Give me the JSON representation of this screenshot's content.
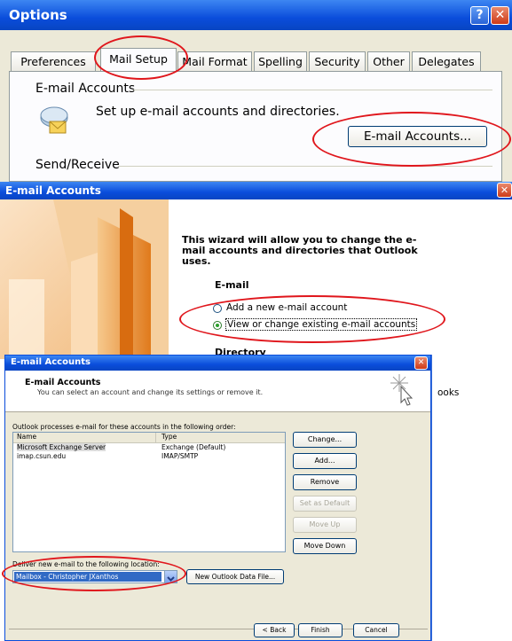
{
  "options": {
    "title": "Options",
    "help_glyph": "?",
    "close_glyph": "✕",
    "tabs": [
      "Preferences",
      "Mail Setup",
      "Mail Format",
      "Spelling",
      "Security",
      "Other",
      "Delegates"
    ],
    "active_tab": "Mail Setup",
    "email_accounts_heading": "E-mail Accounts",
    "email_accounts_desc": "Set up e-mail accounts and directories.",
    "email_accounts_button": "E-mail Accounts...",
    "send_receive_heading": "Send/Receive"
  },
  "wizard": {
    "title": "E-mail Accounts",
    "intro": "This wizard will allow you to change the e-mail accounts and directories that Outlook uses.",
    "email_heading": "E-mail",
    "radio_add": "Add a new e-mail account",
    "radio_view": "View or change existing e-mail accounts",
    "directory_heading": "Directory",
    "partial_text": "ooks"
  },
  "accounts": {
    "title": "E-mail Accounts",
    "header_title": "E-mail Accounts",
    "header_subtitle": "You can select an account and change its settings or remove it.",
    "order_label": "Outlook processes e-mail for these accounts in the following order:",
    "columns": [
      "Name",
      "Type"
    ],
    "rows": [
      {
        "name": "Microsoft Exchange Server",
        "type": "Exchange (Default)"
      },
      {
        "name": "imap.csun.edu",
        "type": "IMAP/SMTP"
      }
    ],
    "buttons": {
      "change": "Change...",
      "add": "Add...",
      "remove": "Remove",
      "set_default": "Set as Default",
      "move_up": "Move Up",
      "move_down": "Move Down"
    },
    "deliver_label": "Deliver new e-mail to the following location:",
    "deliver_value": "Mailbox - Christopher JXanthos",
    "new_data_file": "New Outlook Data File...",
    "back": "< Back",
    "finish": "Finish",
    "cancel": "Cancel"
  },
  "colors": {
    "xp_blue": "#0a4ddb",
    "dialog_bg": "#ece9d8",
    "annotation_red": "#e0161c",
    "selection_blue": "#316ac5"
  }
}
